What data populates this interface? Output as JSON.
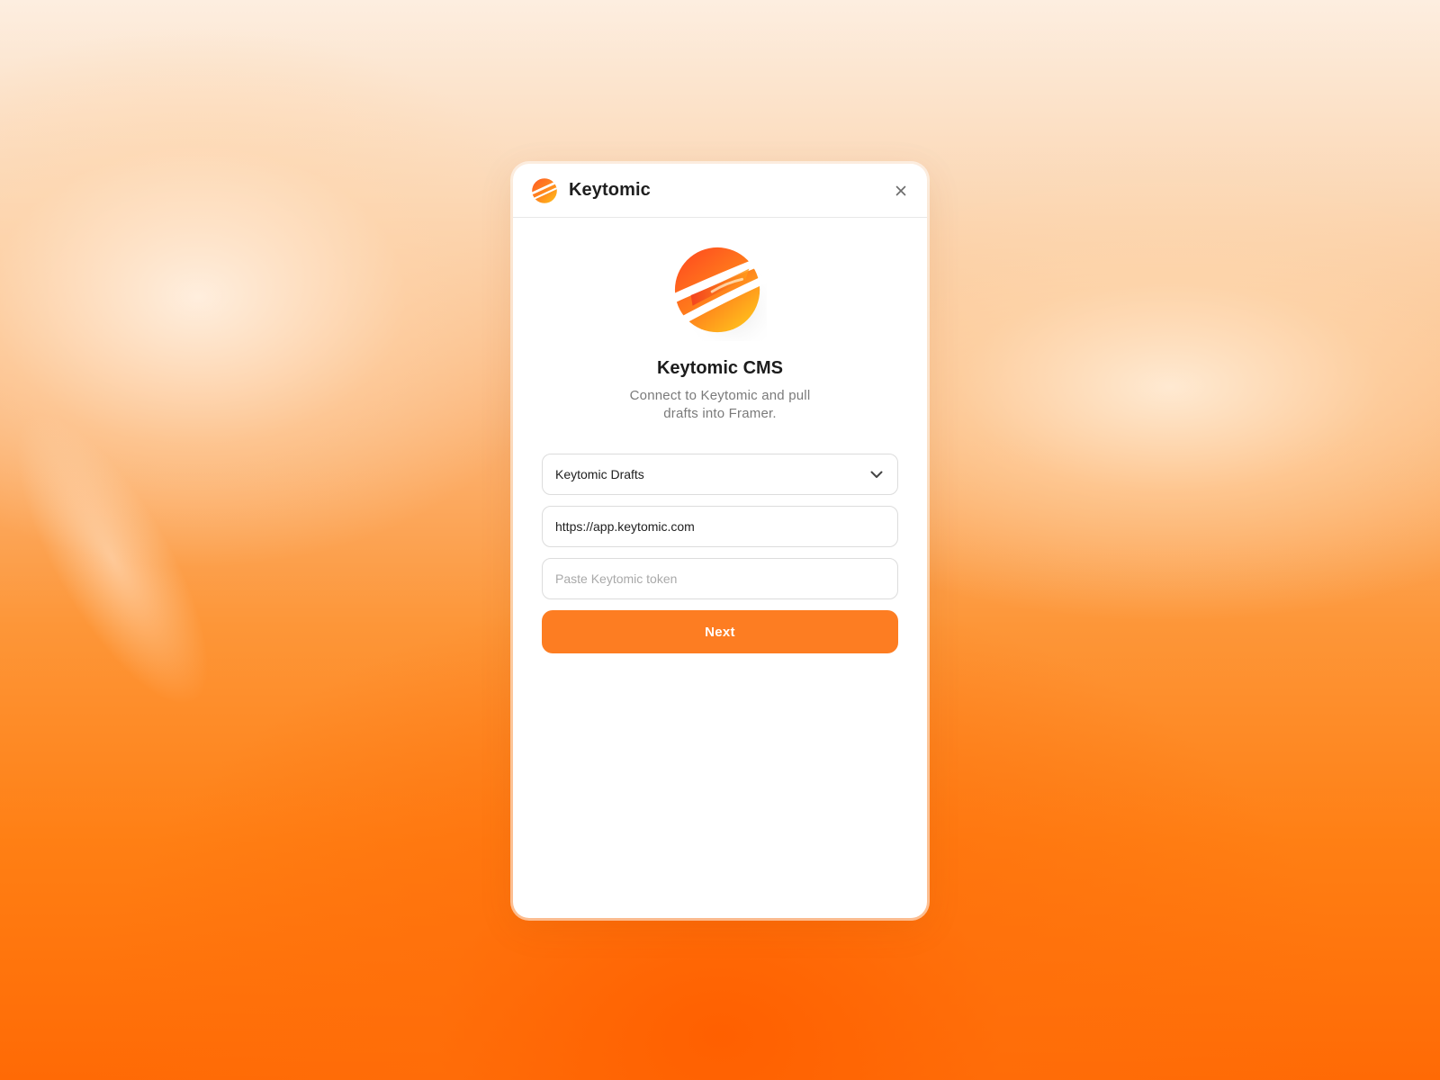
{
  "header": {
    "title": "Keytomic",
    "logo_icon": "keytomic-logo-icon",
    "close_icon": "close-icon"
  },
  "hero": {
    "name": "Keytomic CMS",
    "description": "Connect to Keytomic and pull drafts into Framer."
  },
  "form": {
    "collection_select": {
      "value": "Keytomic Drafts",
      "icon": "chevron-down-icon"
    },
    "url_input": {
      "value": "https://app.keytomic.com"
    },
    "token_input": {
      "value": "",
      "placeholder": "Paste Keytomic token"
    },
    "next_label": "Next"
  },
  "colors": {
    "accent": "#fd7d22",
    "logo_orange": "#f9461f",
    "logo_yellow": "#ffc21a"
  }
}
